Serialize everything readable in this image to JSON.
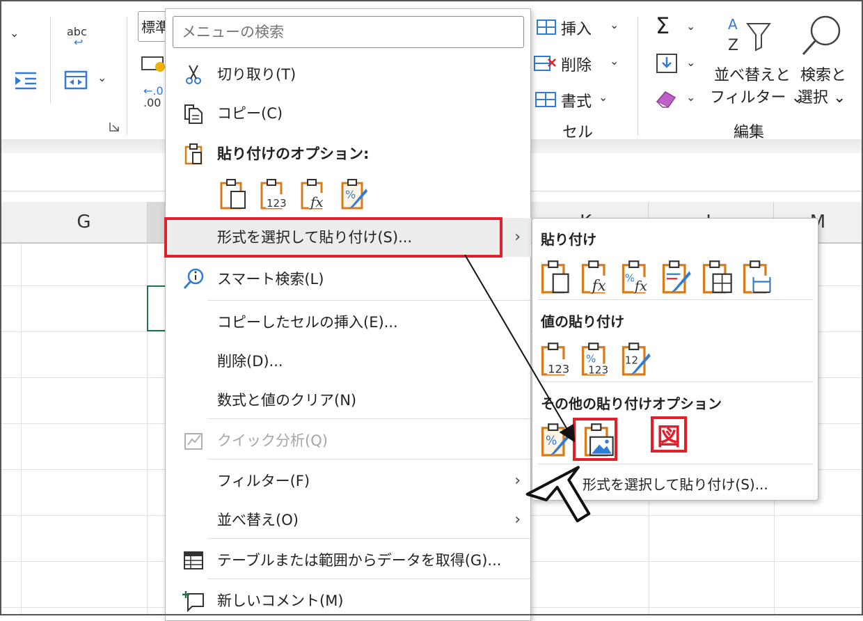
{
  "ribbon": {
    "number_format": "標準",
    "cells_group": {
      "insert": "挿入",
      "delete": "削除",
      "format": "書式",
      "label": "セル"
    },
    "editing_group": {
      "sort_filter_1": "並べ替えと",
      "sort_filter_2": "フィルター",
      "find_select_1": "検索と",
      "find_select_2": "選択",
      "label": "編集"
    },
    "spelling_icon_text": "abc"
  },
  "columns": [
    "G",
    "K",
    "L",
    "M"
  ],
  "menu": {
    "search_placeholder": "メニューの検索",
    "cut": "切り取り(T)",
    "copy": "コピー(C)",
    "paste_options_header": "貼り付けのオプション:",
    "paste_special": "形式を選択して貼り付け(S)...",
    "smart_lookup": "スマート検索(L)",
    "insert_copied": "コピーしたセルの挿入(E)...",
    "delete": "削除(D)...",
    "clear_contents": "数式と値のクリア(N)",
    "quick_analysis": "クイック分析(Q)",
    "filter": "フィルター(F)",
    "sort": "並べ替え(O)",
    "get_data": "テーブルまたは範囲からデータを取得(G)...",
    "new_comment": "新しいコメント(M)"
  },
  "submenu": {
    "paste_header": "貼り付け",
    "values_header": "値の貼り付け",
    "other_header": "その他の貼り付けオプション",
    "paste_special": "形式を選択して貼り付け(S)...",
    "annotation": "図"
  },
  "colors": {
    "accent": "#e0202a",
    "office_orange": "#d77b1c",
    "excel_green": "#217346",
    "blue": "#2f7bd6"
  }
}
